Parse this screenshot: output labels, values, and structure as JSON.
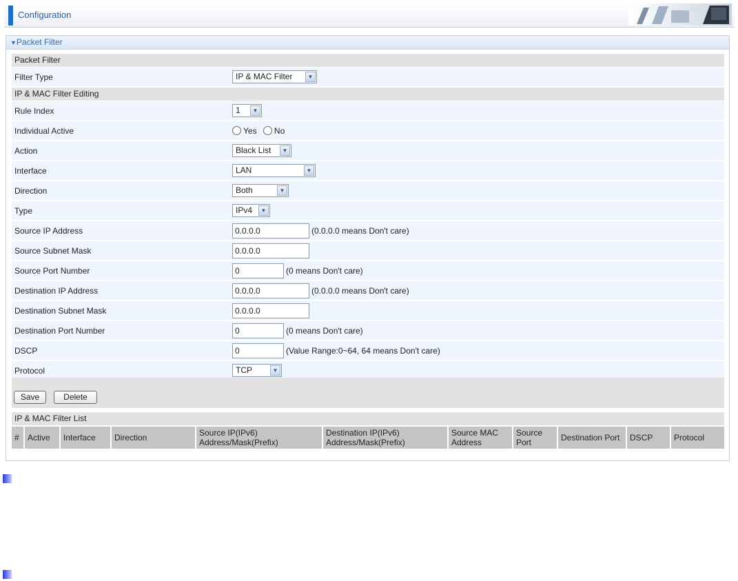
{
  "header": {
    "title": "Configuration"
  },
  "panel": {
    "title": "Packet Filter"
  },
  "sections": {
    "packet_filter": "Packet Filter",
    "editing": "IP & MAC Filter Editing",
    "list": "IP & MAC Filter List"
  },
  "filter_type": {
    "label": "Filter Type",
    "value": "IP & MAC Filter"
  },
  "rule_index": {
    "label": "Rule Index",
    "value": "1"
  },
  "individual_active": {
    "label": "Individual Active",
    "yes": "Yes",
    "no": "No"
  },
  "action": {
    "label": "Action",
    "value": "Black List"
  },
  "interface": {
    "label": "Interface",
    "value": "LAN"
  },
  "direction": {
    "label": "Direction",
    "value": "Both"
  },
  "type": {
    "label": "Type",
    "value": "IPv4"
  },
  "source_ip": {
    "label": "Source IP Address",
    "value": "0.0.0.0",
    "hint": "(0.0.0.0 means Don't care)"
  },
  "source_mask": {
    "label": "Source Subnet Mask",
    "value": "0.0.0.0"
  },
  "source_port": {
    "label": "Source Port Number",
    "value": "0",
    "hint": "(0 means Don't care)"
  },
  "dest_ip": {
    "label": "Destination IP Address",
    "value": "0.0.0.0",
    "hint": "(0.0.0.0 means Don't care)"
  },
  "dest_mask": {
    "label": "Destination Subnet Mask",
    "value": "0.0.0.0"
  },
  "dest_port": {
    "label": "Destination Port Number",
    "value": "0",
    "hint": "(0 means Don't care)"
  },
  "dscp": {
    "label": "DSCP",
    "value": "0",
    "hint": "(Value Range:0~64, 64 means Don't care)"
  },
  "protocol": {
    "label": "Protocol",
    "value": "TCP"
  },
  "buttons": {
    "save": "Save",
    "delete": "Delete"
  },
  "list_columns": {
    "num": "#",
    "active": "Active",
    "interface": "Interface",
    "direction": "Direction",
    "source_ip_1": "Source IP(IPv6)",
    "source_ip_2": "Address/Mask(Prefix)",
    "dest_ip_1": "Destination IP(IPv6)",
    "dest_ip_2": "Address/Mask(Prefix)",
    "source_mac_1": "Source MAC",
    "source_mac_2": "Address",
    "source_port_1": "Source",
    "source_port_2": "Port",
    "dest_port": "Destination Port",
    "dscp": "DSCP",
    "protocol": "Protocol"
  },
  "colors": {
    "accent": "#1f6fc2",
    "row_bg": "#eef5fd",
    "section_bg": "#e2e2e2",
    "table_header_bg": "#c4c4c4"
  }
}
